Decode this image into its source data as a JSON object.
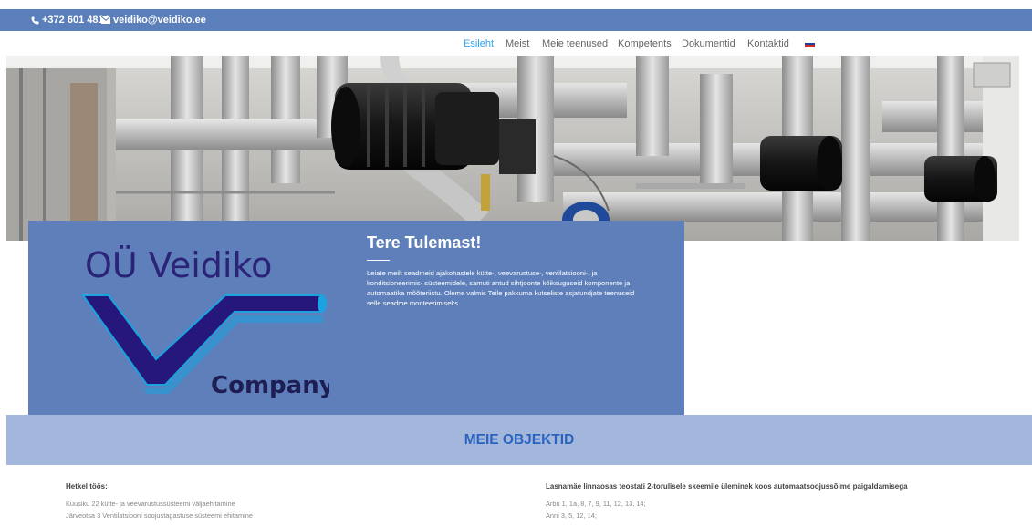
{
  "topbar": {
    "phone": "+372 601 4814",
    "email": "veidiko@veidiko.ee",
    "background": "#5b7fba"
  },
  "nav": {
    "items": [
      "Esileht",
      "Meist",
      "Meie teenused",
      "Kompetents",
      "Dokumentid",
      "Kontaktid"
    ],
    "active": "Esileht",
    "language_flag": "russian-flag-icon"
  },
  "hero": {
    "subject": "industrial pumps and insulated pipes photograph"
  },
  "intro": {
    "logo": {
      "company_name": "OÜ Veidiko",
      "tagline": "Company"
    },
    "title": "Tere Tulemast!",
    "text": "Leiate meilt seadmeid ajakohastele kütte-, veevarustuse-, ventilatsiooni-, ja konditsioneerimis- süsteemidele,  samuti antud sihtjoonte kõiksuguseid komponente ja automaatika mõõteriistu. Oleme valmis Teile pakkuma kutseliste asjatundjate teenuseid selle seadme monteerimiseks.",
    "background": "#5e7fb9"
  },
  "objects": {
    "title": "MEIE OBJEKTID",
    "band_color": "#a3b7dd",
    "left": {
      "heading": "Hetkel töös:",
      "lines": [
        "Kuusiku 22 kütte- ja veevarustussüsteemi väljaehitamine",
        " Järveotsa 3 Ventilatsiooni soojustagastuse süsteemi ehitamine"
      ]
    },
    "right": {
      "heading": "Lasnamäe linnaosas teostati 2-torulisele skeemile üleminek koos automaatsoojussõlme paigaldamisega",
      "lines": [
        "Arbu 1, 1a, 8, 7, 9, 11, 12, 13, 14;",
        "Anni 3, 5, 12, 14;"
      ]
    }
  }
}
